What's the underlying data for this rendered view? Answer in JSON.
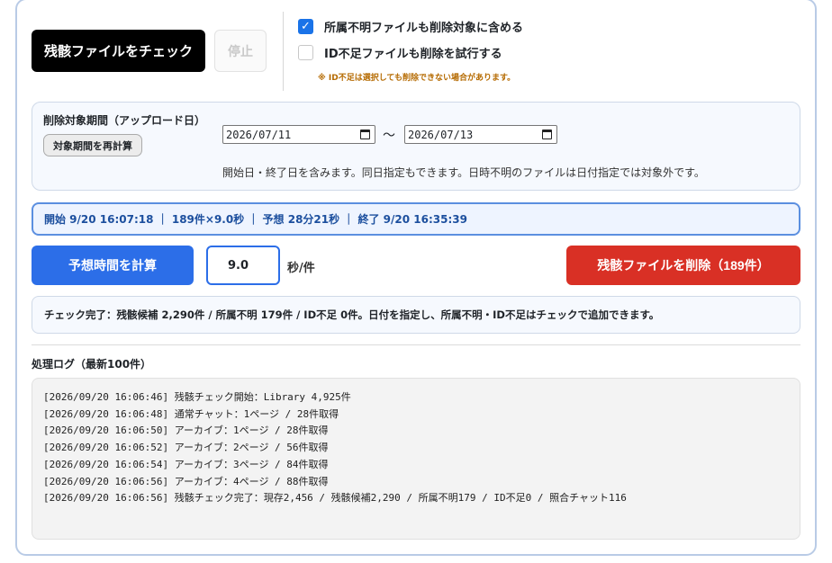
{
  "controls": {
    "check_label": "残骸ファイルをチェック",
    "stop_label": "停止"
  },
  "options": {
    "include_unknown_label": "所属不明ファイルも削除対象に含める",
    "include_unknown_checked": true,
    "try_missing_id_label": "ID不足ファイルも削除を試行する",
    "try_missing_id_checked": false,
    "warning": "※ ID不足は選択しても削除できない場合があります。"
  },
  "period": {
    "title": "削除対象期間（アップロード日）",
    "recalc_label": "対象期間を再計算",
    "start_date": "2026/07/11",
    "tilde": "〜",
    "end_date": "2026/07/13",
    "note": "開始日・終了日を含みます。同日指定もできます。日時不明のファイルは日付指定では対象外です。"
  },
  "summary": "開始 9/20 16:07:18 ｜ 189件×9.0秒 ｜ 予想 28分21秒 ｜ 終了 9/20 16:35:39",
  "estimate": {
    "button_label": "予想時間を計算",
    "seconds_value": "9.0",
    "unit": "秒/件"
  },
  "delete_label": "残骸ファイルを削除（189件）",
  "status_text": "チェック完了：残骸候補 2,290件 / 所属不明 179件 / ID不足 0件。日付を指定し、所属不明・ID不足はチェックで追加できます。",
  "log": {
    "title": "処理ログ（最新100件）",
    "lines": [
      "[2026/09/20 16:06:46] 残骸チェック開始：Library 4,925件",
      "[2026/09/20 16:06:48] 通常チャット：1ページ / 28件取得",
      "[2026/09/20 16:06:50] アーカイブ：1ページ / 28件取得",
      "[2026/09/20 16:06:52] アーカイブ：2ページ / 56件取得",
      "[2026/09/20 16:06:54] アーカイブ：3ページ / 84件取得",
      "[2026/09/20 16:06:56] アーカイブ：4ページ / 88件取得",
      "[2026/09/20 16:06:56] 残骸チェック完了：現存2,456 / 残骸候補2,290 / 所属不明179 / ID不足0 / 照合チャット116"
    ]
  },
  "colors": {
    "primary": "#2c6ee8",
    "danger": "#d93025",
    "checkbox": "#1a73e8",
    "warning": "#b56a00",
    "summary_text": "#1c4f9e"
  },
  "icons": {
    "checkbox_checked": "checkmark-icon",
    "date_picker": "calendar-icon"
  }
}
